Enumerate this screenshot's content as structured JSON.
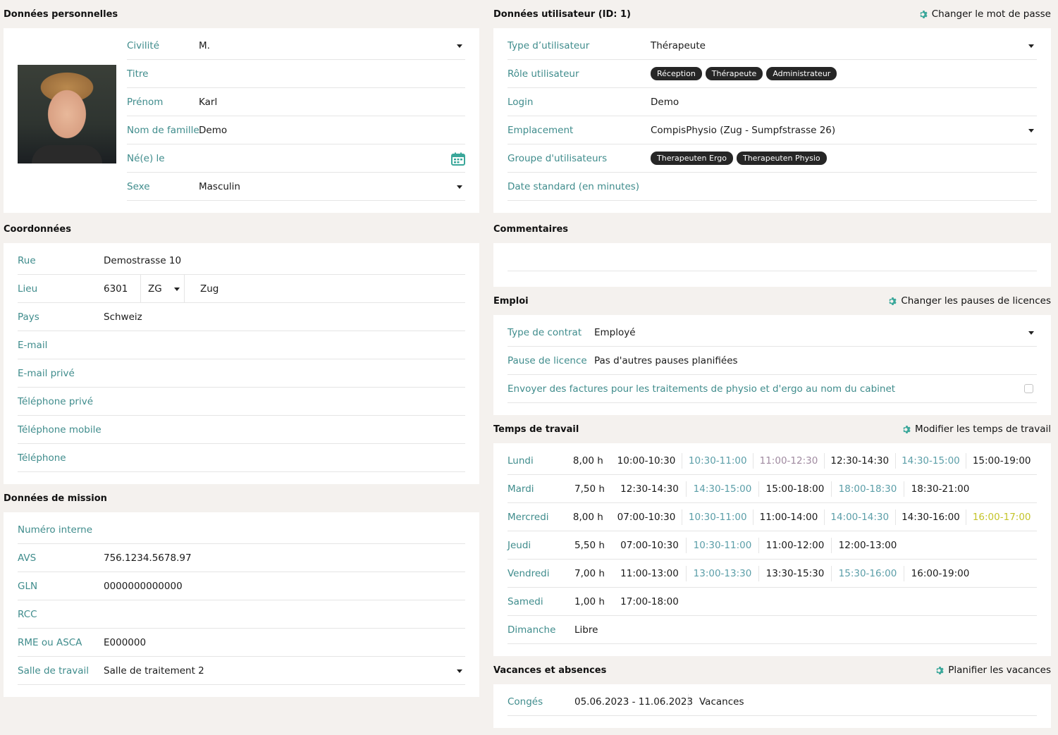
{
  "colors": {
    "label": "#3f8c8c",
    "accent": "#3aa79a",
    "chip_bg": "#262626",
    "slot_normal": "#1a1a1a",
    "slot_teal": "#5b9ea8",
    "slot_mauve": "#a08aa0",
    "slot_yellow": "#c4c42a"
  },
  "personal": {
    "title": "Données personnelles",
    "fields": [
      {
        "label": "Civilité",
        "value": "M.",
        "dropdown": true
      },
      {
        "label": "Titre",
        "value": ""
      },
      {
        "label": "Prénom",
        "value": "Karl"
      },
      {
        "label": "Nom de famille",
        "value": "Demo"
      },
      {
        "label": "Né(e) le",
        "value": "",
        "icon": "calendar-icon"
      },
      {
        "label": "Sexe",
        "value": "Masculin",
        "dropdown": true
      }
    ]
  },
  "coordinates": {
    "title": "Coordonnées",
    "rue": {
      "label": "Rue",
      "value": "Demostrasse 10"
    },
    "lieu": {
      "label": "Lieu",
      "zip": "6301",
      "canton": "ZG",
      "city": "Zug"
    },
    "fields": [
      {
        "label": "Pays",
        "value": "Schweiz"
      },
      {
        "label": "E-mail",
        "value": ""
      },
      {
        "label": "E-mail privé",
        "value": ""
      },
      {
        "label": "Téléphone privé",
        "value": ""
      },
      {
        "label": "Téléphone mobile",
        "value": ""
      },
      {
        "label": "Téléphone",
        "value": ""
      }
    ]
  },
  "mission": {
    "title": "Données de mission",
    "fields": [
      {
        "label": "Numéro interne",
        "value": ""
      },
      {
        "label": "AVS",
        "value": "756.1234.5678.97"
      },
      {
        "label": "GLN",
        "value": "0000000000000"
      },
      {
        "label": "RCC",
        "value": ""
      },
      {
        "label": "RME ou ASCA",
        "value": "E000000"
      },
      {
        "label": "Salle de travail",
        "value": "Salle de traitement 2",
        "dropdown": true
      }
    ]
  },
  "user": {
    "title": "Données utilisateur (ID: 1)",
    "action": "Changer le mot de passe",
    "type": {
      "label": "Type d’utilisateur",
      "value": "Thérapeute"
    },
    "role": {
      "label": "Rôle utilisateur",
      "chips": [
        "Réception",
        "Thérapeute",
        "Administrateur"
      ]
    },
    "login": {
      "label": "Login",
      "value": "Demo"
    },
    "location": {
      "label": "Emplacement",
      "value": "CompisPhysio (Zug - Sumpfstrasse 26)"
    },
    "groups": {
      "label": "Groupe d'utilisateurs",
      "chips": [
        "Therapeuten Ergo",
        "Therapeuten Physio"
      ]
    },
    "standard": {
      "label": "Date standard (en minutes)",
      "value": ""
    }
  },
  "comments": {
    "title": "Commentaires",
    "value": ""
  },
  "employment": {
    "title": "Emploi",
    "action": "Changer les pauses de licences",
    "contract": {
      "label": "Type de contrat",
      "value": "Employé"
    },
    "pause": {
      "label": "Pause de licence",
      "value": "Pas d'autres pauses planifiées"
    },
    "invoice": {
      "label": "Envoyer des factures pour les traitements de physio et d'ergo au nom du cabinet",
      "checked": false
    }
  },
  "worktime": {
    "title": "Temps de travail",
    "action": "Modifier les temps de travail",
    "days": [
      {
        "day": "Lundi",
        "hours": "8,00 h",
        "slots": [
          {
            "t": "10:00-10:30",
            "c": "normal"
          },
          {
            "t": "10:30-11:00",
            "c": "teal"
          },
          {
            "t": "11:00-12:30",
            "c": "mauve"
          },
          {
            "t": "12:30-14:30",
            "c": "normal"
          },
          {
            "t": "14:30-15:00",
            "c": "teal"
          },
          {
            "t": "15:00-19:00",
            "c": "normal"
          }
        ]
      },
      {
        "day": "Mardi",
        "hours": "7,50 h",
        "slots": [
          {
            "t": "12:30-14:30",
            "c": "normal"
          },
          {
            "t": "14:30-15:00",
            "c": "teal"
          },
          {
            "t": "15:00-18:00",
            "c": "normal"
          },
          {
            "t": "18:00-18:30",
            "c": "teal"
          },
          {
            "t": "18:30-21:00",
            "c": "normal"
          }
        ]
      },
      {
        "day": "Mercredi",
        "hours": "8,00 h",
        "slots": [
          {
            "t": "07:00-10:30",
            "c": "normal"
          },
          {
            "t": "10:30-11:00",
            "c": "teal"
          },
          {
            "t": "11:00-14:00",
            "c": "normal"
          },
          {
            "t": "14:00-14:30",
            "c": "teal"
          },
          {
            "t": "14:30-16:00",
            "c": "normal"
          },
          {
            "t": "16:00-17:00",
            "c": "yellow"
          }
        ]
      },
      {
        "day": "Jeudi",
        "hours": "5,50 h",
        "slots": [
          {
            "t": "07:00-10:30",
            "c": "normal"
          },
          {
            "t": "10:30-11:00",
            "c": "teal"
          },
          {
            "t": "11:00-12:00",
            "c": "normal"
          },
          {
            "t": "12:00-13:00",
            "c": "normal"
          }
        ]
      },
      {
        "day": "Vendredi",
        "hours": "7,00 h",
        "slots": [
          {
            "t": "11:00-13:00",
            "c": "normal"
          },
          {
            "t": "13:00-13:30",
            "c": "teal"
          },
          {
            "t": "13:30-15:30",
            "c": "normal"
          },
          {
            "t": "15:30-16:00",
            "c": "teal"
          },
          {
            "t": "16:00-19:00",
            "c": "normal"
          }
        ]
      },
      {
        "day": "Samedi",
        "hours": "1,00 h",
        "slots": [
          {
            "t": "17:00-18:00",
            "c": "normal"
          }
        ]
      },
      {
        "day": "Dimanche",
        "hours": "Libre",
        "slots": []
      }
    ]
  },
  "vacation": {
    "title": "Vacances et absences",
    "action": "Planifier les vacances",
    "entries": [
      {
        "label": "Congés",
        "dates": "05.06.2023 - 11.06.2023",
        "type": "Vacances"
      }
    ]
  }
}
